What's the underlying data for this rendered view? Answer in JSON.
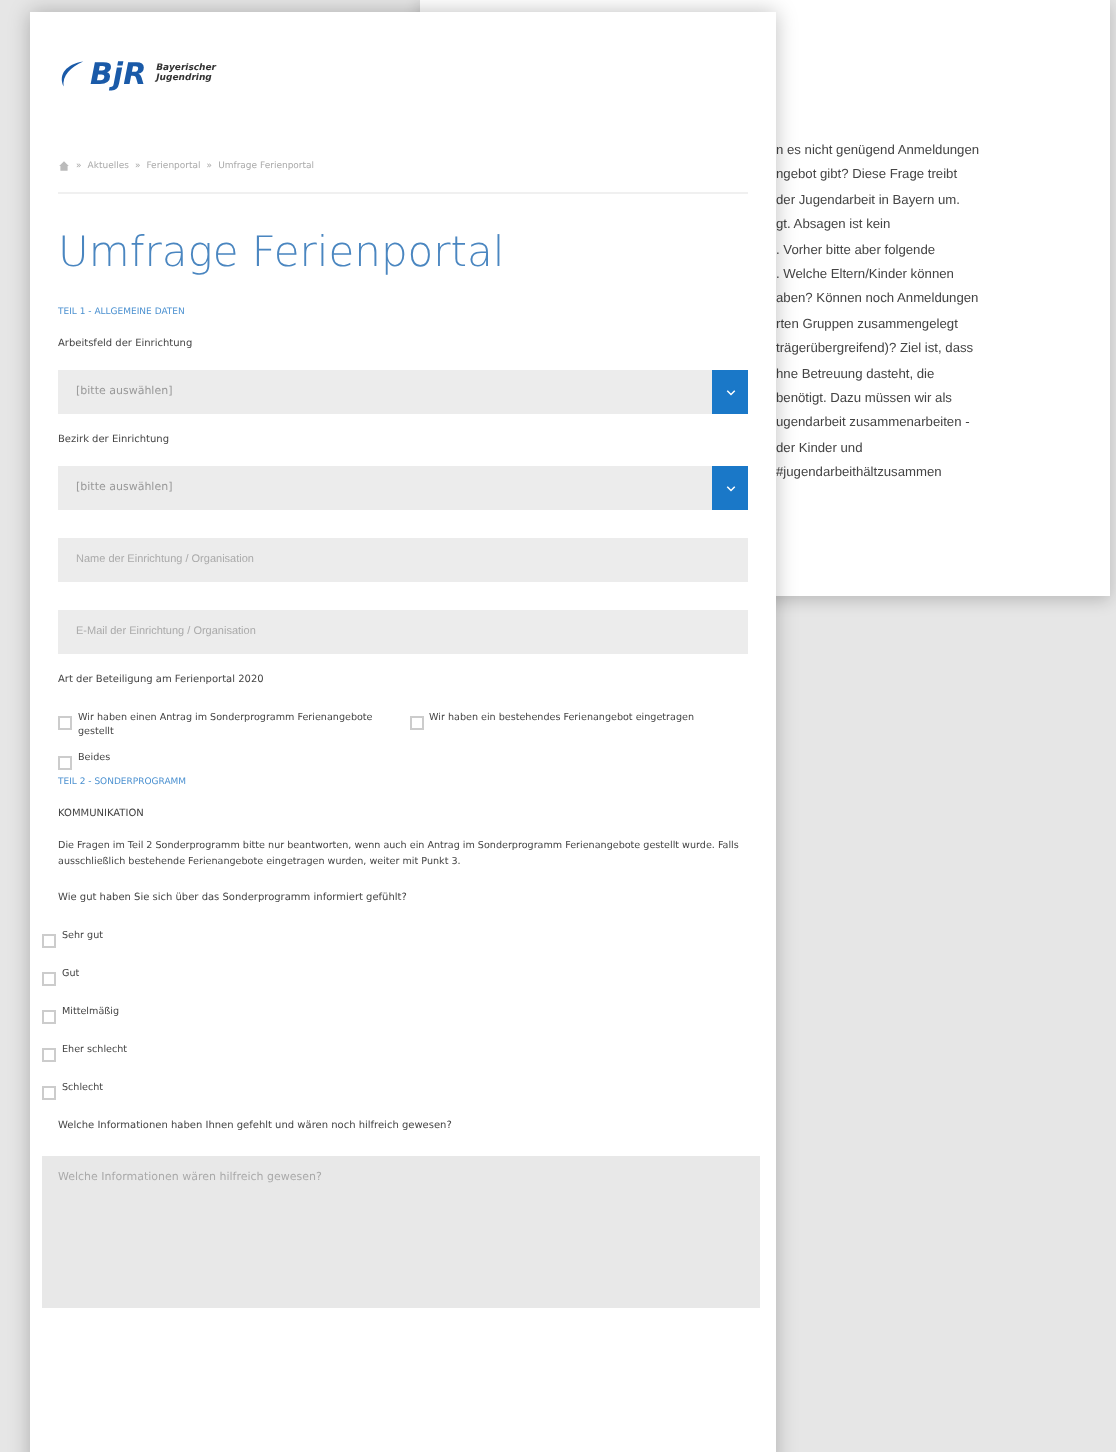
{
  "back_page": {
    "lines": [
      "n es nicht genügend Anmeldungen",
      "ngebot gibt? Diese Frage treibt",
      "der Jugendarbeit in Bayern um.",
      "gt. Absagen ist kein",
      ". Vorher bitte aber folgende",
      ". Welche Eltern/Kinder können",
      "aben? Können noch Anmeldungen",
      "rten Gruppen zusammengelegt",
      "trägerübergreifend)? Ziel ist, dass",
      "hne Betreuung dasteht, die",
      "benötigt. Dazu müssen wir als",
      "ugendarbeit zusammenarbeiten -",
      "der Kinder und",
      "#jugendarbeithältzusammen"
    ]
  },
  "logo": {
    "mark": "BjR",
    "name_line1": "Bayerischer",
    "name_line2": "Jugendring"
  },
  "breadcrumb": [
    "»",
    "Aktuelles",
    "»",
    "Ferienportal",
    "»",
    "Umfrage Ferienportal"
  ],
  "title": "Umfrage Ferienportal",
  "form": [
    {
      "kind": "section",
      "text": "TEIL 1 - ALLGEMEINE DATEN"
    },
    {
      "kind": "label",
      "text": "Arbeitsfeld der Einrichtung"
    },
    {
      "kind": "select",
      "value": "[bitte auswählen]"
    },
    {
      "kind": "label",
      "text": "Bezirk der Einrichtung"
    },
    {
      "kind": "select",
      "value": "[bitte auswählen]"
    },
    {
      "kind": "input",
      "placeholder": "Name der Einrichtung / Organisation"
    },
    {
      "kind": "input",
      "placeholder": "E-Mail der Einrichtung / Organisation"
    },
    {
      "kind": "label",
      "text": "Art der Beteiligung am Ferienportal 2020"
    },
    {
      "kind": "checkgrid",
      "options": [
        {
          "label": "Wir haben einen Antrag im Sonderprogramm Ferienangebote gestellt",
          "checked": false
        },
        {
          "label": "Wir haben ein bestehendes Ferienangebot eingetragen",
          "checked": false
        },
        {
          "label": "Beides",
          "checked": false
        }
      ]
    },
    {
      "kind": "section",
      "text": "TEIL 2 - SONDERPROGRAMM"
    },
    {
      "kind": "label",
      "text": "KOMMUNIKATION"
    },
    {
      "kind": "paragraph",
      "text": "Die Fragen im Teil 2 Sonderprogramm bitte nur beantworten, wenn auch ein Antrag im Sonderprogramm Ferienangebote gestellt wurde. Falls ausschließlich bestehende Ferienangebote eingetragen wurden, weiter mit Punkt 3."
    },
    {
      "kind": "label",
      "text": "Wie gut haben Sie sich über das Sonderprogramm informiert gefühlt?"
    },
    {
      "kind": "checklist",
      "options": [
        {
          "label": "Sehr gut",
          "checked": false
        },
        {
          "label": "Gut",
          "checked": false
        },
        {
          "label": "Mittelmäßig",
          "checked": false
        },
        {
          "label": "Eher schlecht",
          "checked": false
        },
        {
          "label": "Schlecht",
          "checked": false
        }
      ]
    },
    {
      "kind": "label",
      "text": "Welche Informationen haben Ihnen gefehlt und wären noch hilfreich gewesen?"
    },
    {
      "kind": "textarea",
      "placeholder": "Welche Informationen wären hilfreich gewesen?"
    }
  ]
}
